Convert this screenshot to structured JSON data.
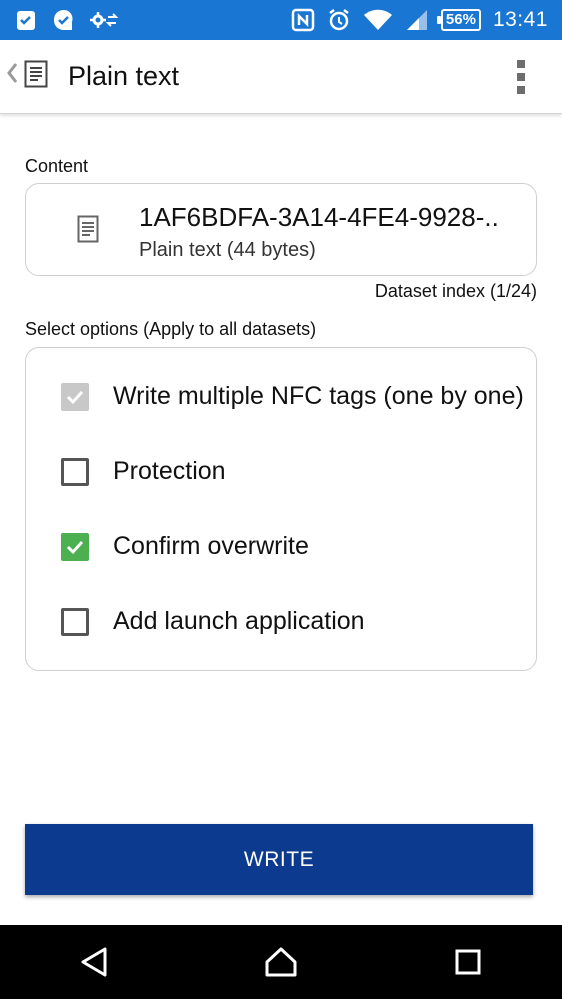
{
  "status_bar": {
    "battery": "56%",
    "time": "13:41"
  },
  "toolbar": {
    "title": "Plain text"
  },
  "content": {
    "label": "Content",
    "title": "1AF6BDFA-3A14-4FE4-9928-..",
    "subtitle": "Plain text (44 bytes)",
    "dataset_index": "Dataset index (1/24)"
  },
  "options": {
    "label": "Select options (Apply to all datasets)",
    "items": [
      {
        "label": "Write multiple NFC tags (one by one)",
        "state": "checked-disabled"
      },
      {
        "label": "Protection",
        "state": "unchecked"
      },
      {
        "label": "Confirm overwrite",
        "state": "checked"
      },
      {
        "label": "Add launch application",
        "state": "unchecked"
      }
    ]
  },
  "write_button": {
    "label": "WRITE"
  },
  "colors": {
    "status_bar": "#1976d2",
    "write_button": "#0b3a8f",
    "checkbox_checked": "#4caf50",
    "checkbox_disabled": "#c8c8c8"
  }
}
